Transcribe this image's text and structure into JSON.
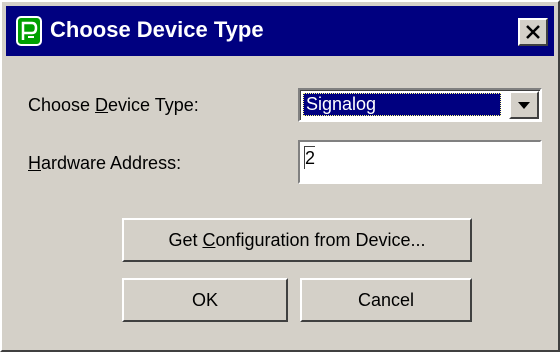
{
  "window": {
    "title": "Choose Device Type",
    "app_icon": "device-app-icon",
    "close_icon": "close-x-icon"
  },
  "form": {
    "device_type_label_pre": "Choose ",
    "device_type_label_key": "D",
    "device_type_label_post": "evice Type:",
    "device_type_value": "Signalog",
    "dropdown_icon": "chevron-down-icon",
    "hardware_address_label_key": "H",
    "hardware_address_label_post": "ardware Address:",
    "hardware_address_value": "2"
  },
  "buttons": {
    "get_config_pre": "Get ",
    "get_config_key": "C",
    "get_config_post": "onfiguration from Device...",
    "ok": "OK",
    "cancel": "Cancel"
  },
  "colors": {
    "titlebar": "#000080",
    "face": "#d4d0c8",
    "selection": "#000080"
  }
}
